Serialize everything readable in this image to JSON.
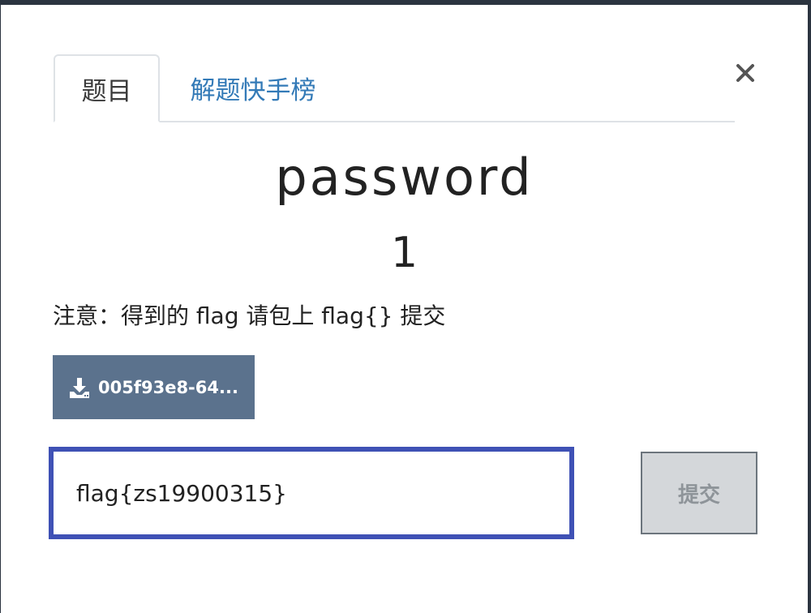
{
  "tabs": [
    {
      "label": "题目",
      "active": true
    },
    {
      "label": "解题快手榜",
      "active": false
    }
  ],
  "close_icon": "close-icon",
  "challenge": {
    "name": "password",
    "points": "1",
    "note": "注意：得到的 flag 请包上 flag{} 提交"
  },
  "download": {
    "icon": "download-icon",
    "label": "005f93e8-64..."
  },
  "flag_input": {
    "value": "flag{zs19900315}"
  },
  "submit": {
    "label": "提交"
  },
  "colors": {
    "tab_link": "#337ab7",
    "download_bg": "#5b728d",
    "input_border": "#3f51b5",
    "submit_bg": "#d4d7da"
  }
}
